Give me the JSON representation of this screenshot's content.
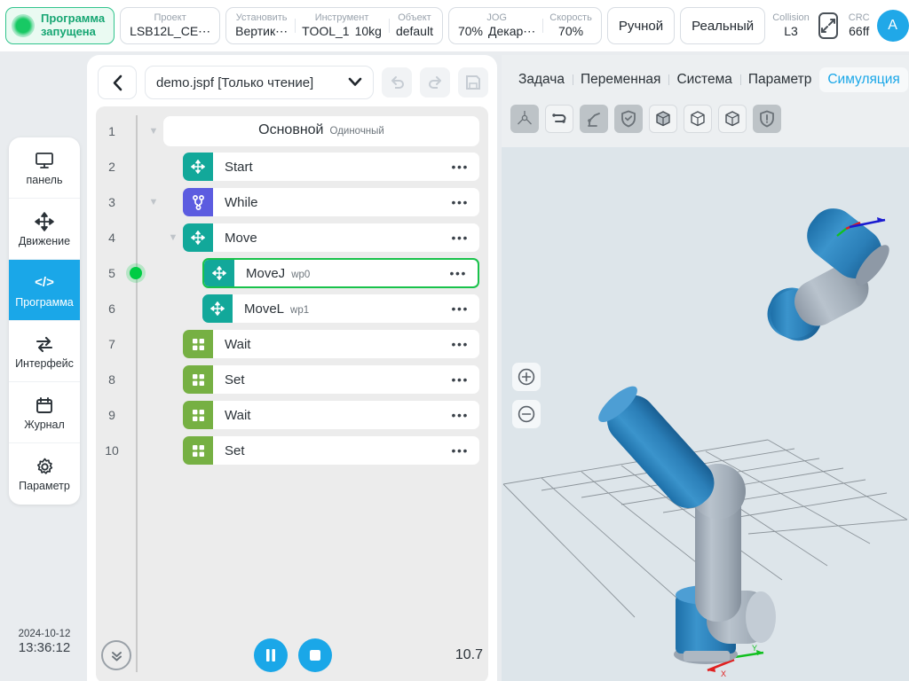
{
  "topbar": {
    "status": {
      "line1": "Программа",
      "line2": "запущена",
      "dot_color": "#18c964"
    },
    "project": {
      "label": "Проект",
      "value": "LSB12L_CE⋯"
    },
    "install": {
      "label": "Установить",
      "value": "Вертик⋯"
    },
    "tool": {
      "label": "Инструмент",
      "value": "TOOL_1",
      "payload": "10kg"
    },
    "object": {
      "label": "Объект",
      "value": "default"
    },
    "jog": {
      "label": "JOG",
      "percent": "70%",
      "mode": "Декар⋯"
    },
    "speed": {
      "label": "Скорость",
      "value": "70%"
    },
    "mode_button": "Ручной",
    "real_button": "Реальный",
    "collision": {
      "label": "Collision",
      "value": "L3"
    },
    "crc": {
      "label": "CRC",
      "value": "66ff"
    },
    "avatar": "A"
  },
  "sidebar": {
    "items": [
      {
        "label": "панель",
        "icon": "monitor-icon",
        "active": false
      },
      {
        "label": "Движение",
        "icon": "move-arrows-icon",
        "active": false
      },
      {
        "label": "Программа",
        "icon": "code-icon",
        "active": true
      },
      {
        "label": "Интерфейс",
        "icon": "exchange-icon",
        "active": false
      },
      {
        "label": "Журнал",
        "icon": "calendar-icon",
        "active": false
      },
      {
        "label": "Параметр",
        "icon": "gear-icon",
        "active": false
      }
    ]
  },
  "clock": {
    "date": "2024-10-12",
    "time": "13:36:12"
  },
  "program": {
    "file_name": "demo.jspf [Только чтение]",
    "rows": [
      {
        "num": "1",
        "type": "root",
        "label": "Основной",
        "sub": "Одиночный",
        "caret": true,
        "indent": 0,
        "selected": false,
        "marker": false
      },
      {
        "num": "2",
        "type": "node",
        "label": "Start",
        "sub": "",
        "icon_color": "teal",
        "icon": "move-arrows-icon",
        "caret": false,
        "indent": 1,
        "selected": false,
        "marker": false
      },
      {
        "num": "3",
        "type": "node",
        "label": "While",
        "sub": "",
        "icon_color": "purple",
        "icon": "branch-icon",
        "caret": true,
        "indent": 1,
        "selected": false,
        "marker": false
      },
      {
        "num": "4",
        "type": "node",
        "label": "Move",
        "sub": "",
        "icon_color": "teal",
        "icon": "move-arrows-icon",
        "caret": true,
        "indent": 2,
        "selected": false,
        "marker": false
      },
      {
        "num": "5",
        "type": "node",
        "label": "MoveJ",
        "sub": "wp0",
        "icon_color": "teal",
        "icon": "move-arrows-icon",
        "caret": false,
        "indent": 3,
        "selected": true,
        "marker": true
      },
      {
        "num": "6",
        "type": "node",
        "label": "MoveL",
        "sub": "wp1",
        "icon_color": "teal",
        "icon": "move-arrows-icon",
        "caret": false,
        "indent": 3,
        "selected": false,
        "marker": false
      },
      {
        "num": "7",
        "type": "node",
        "label": "Wait",
        "sub": "",
        "icon_color": "green",
        "icon": "grid-squares-icon",
        "caret": false,
        "indent": 1,
        "selected": false,
        "marker": false
      },
      {
        "num": "8",
        "type": "node",
        "label": "Set",
        "sub": "",
        "icon_color": "green",
        "icon": "grid-squares-icon",
        "caret": false,
        "indent": 1,
        "selected": false,
        "marker": false
      },
      {
        "num": "9",
        "type": "node",
        "label": "Wait",
        "sub": "",
        "icon_color": "green",
        "icon": "grid-squares-icon",
        "caret": false,
        "indent": 1,
        "selected": false,
        "marker": false
      },
      {
        "num": "10",
        "type": "node",
        "label": "Set",
        "sub": "",
        "icon_color": "green",
        "icon": "grid-squares-icon",
        "caret": false,
        "indent": 1,
        "selected": false,
        "marker": false
      }
    ],
    "row_menu_label": "•••",
    "footer": {
      "timer": "10.7"
    }
  },
  "simulation": {
    "tabs": [
      {
        "label": "Задача",
        "active": false
      },
      {
        "label": "Переменная",
        "active": false
      },
      {
        "label": "Система",
        "active": false
      },
      {
        "label": "Параметр",
        "active": false
      },
      {
        "label": "Симуляция",
        "active": true
      }
    ],
    "tools": [
      {
        "name": "axes-icon",
        "state": "on"
      },
      {
        "name": "path-icon",
        "state": "off"
      },
      {
        "name": "robot-icon",
        "state": "on"
      },
      {
        "name": "shield-check-icon",
        "state": "on"
      },
      {
        "name": "cube-solid-icon",
        "state": "off"
      },
      {
        "name": "cube-wire-icon",
        "state": "off"
      },
      {
        "name": "cube-shaded-icon",
        "state": "off"
      },
      {
        "name": "shield-warning-icon",
        "state": "on"
      }
    ],
    "axis_labels": {
      "x": "X",
      "y": "Y"
    }
  }
}
